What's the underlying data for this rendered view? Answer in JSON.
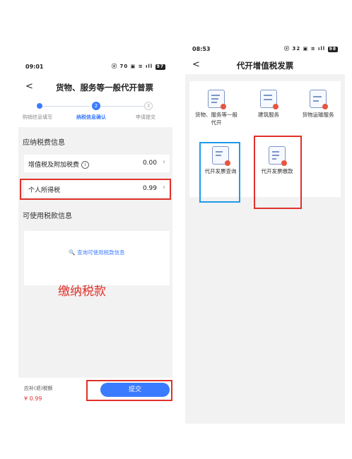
{
  "left_screen": {
    "status_time": "09:01",
    "status_icons": "ⓧ 𝟳𝟬 ▣ ≋ ıll",
    "battery": "97",
    "back_label": "<",
    "title": "货物、服务等一般代开普票",
    "steps": [
      {
        "number": "1",
        "label": "购销信息填写",
        "active": false
      },
      {
        "number": "2",
        "label": "纳税信息确认",
        "active": true
      },
      {
        "number": "3",
        "label": "申请提交",
        "active": false
      }
    ],
    "section_payable": "应纳税费信息",
    "rows": [
      {
        "label": "增值税及附加税费",
        "value": "0.00"
      },
      {
        "label": "个人所得税",
        "value": "0.99"
      }
    ],
    "section_available": "可使用税款信息",
    "query_link": "查询可使用税款信息",
    "annotation": "缴纳税款",
    "due_label": "应补(退)税额",
    "due_amount": "¥ 0.99",
    "submit_label": "提交",
    "highlight_color": "#e0302a",
    "primary_color": "#3b7bff"
  },
  "right_screen": {
    "status_time": "08:53",
    "status_icons": "ⓧ 𝟯𝟮 ▣ ≋ ıll",
    "battery": "98",
    "back_label": "<",
    "title": "代开增值税发票",
    "tiles": [
      {
        "label": "货物、服务等一般代开",
        "icon": "invoice-doc-icon"
      },
      {
        "label": "建筑服务",
        "icon": "building-icon"
      },
      {
        "label": "货物运输服务",
        "icon": "truck-icon"
      },
      {
        "label": "代开发票查询",
        "icon": "search-doc-icon"
      },
      {
        "label": "代开发票缴款",
        "icon": "payment-doc-icon"
      }
    ],
    "query_box_color": "#1e9be8"
  }
}
